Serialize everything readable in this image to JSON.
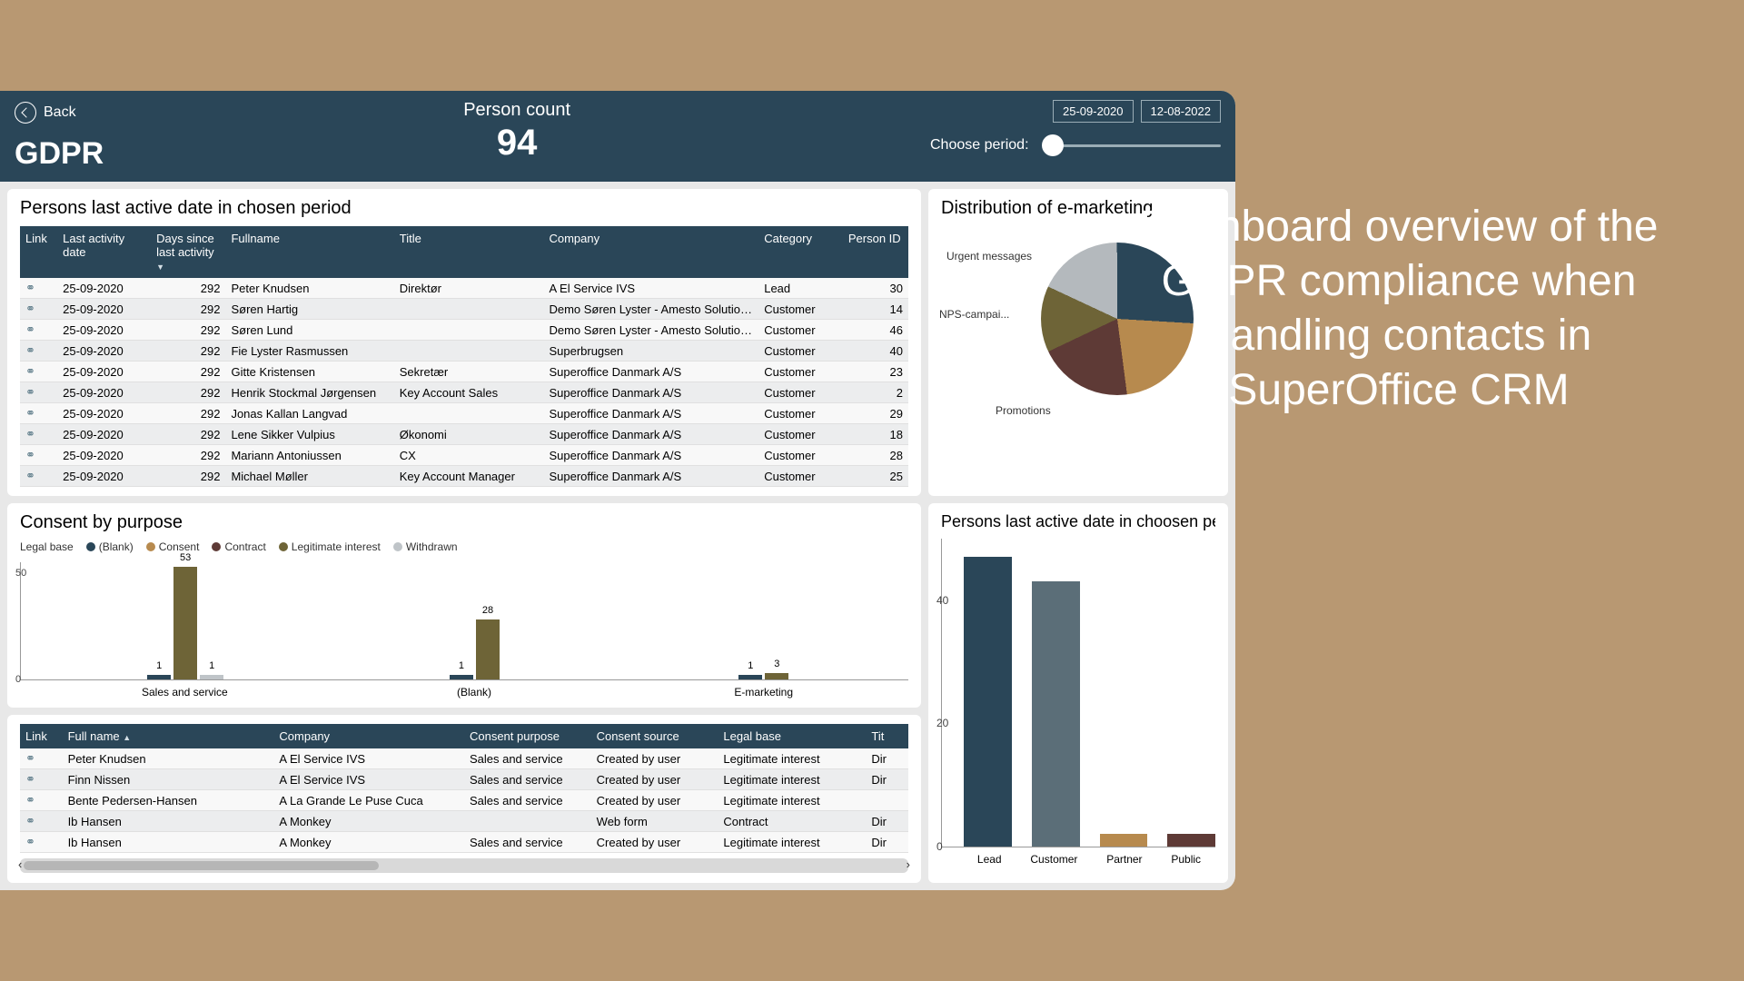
{
  "caption": "Dashboard overview of the GDPR compliance when handling contacts in SuperOffice CRM",
  "header": {
    "back": "Back",
    "title": "GDPR",
    "person_count_label": "Person count",
    "person_count": "94",
    "date_from": "25-09-2020",
    "date_to": "12-08-2022",
    "choose_period": "Choose period:"
  },
  "persons_panel": {
    "title": "Persons last active date in chosen period",
    "cols": [
      "Link",
      "Last activity date",
      "Days since last activity",
      "Fullname",
      "Title",
      "Company",
      "Category",
      "Person ID"
    ],
    "rows": [
      [
        "25-09-2020",
        "292",
        "Peter Knudsen",
        "Direktør",
        "A El Service IVS",
        "Lead",
        "30"
      ],
      [
        "25-09-2020",
        "292",
        "Søren Hartig",
        "",
        "Demo Søren Lyster - Amesto Solutions A/S",
        "Customer",
        "14"
      ],
      [
        "25-09-2020",
        "292",
        "Søren Lund",
        "",
        "Demo Søren Lyster - Amesto Solutions A/S",
        "Customer",
        "46"
      ],
      [
        "25-09-2020",
        "292",
        "Fie Lyster Rasmussen",
        "",
        "Superbrugsen",
        "Customer",
        "40"
      ],
      [
        "25-09-2020",
        "292",
        "Gitte Kristensen",
        "Sekretær",
        "Superoffice Danmark A/S",
        "Customer",
        "23"
      ],
      [
        "25-09-2020",
        "292",
        "Henrik Stockmal Jørgensen",
        "Key Account Sales",
        "Superoffice Danmark A/S",
        "Customer",
        "2"
      ],
      [
        "25-09-2020",
        "292",
        "Jonas Kallan Langvad",
        "",
        "Superoffice Danmark A/S",
        "Customer",
        "29"
      ],
      [
        "25-09-2020",
        "292",
        "Lene Sikker Vulpius",
        "Økonomi",
        "Superoffice Danmark A/S",
        "Customer",
        "18"
      ],
      [
        "25-09-2020",
        "292",
        "Mariann Antoniussen",
        "CX",
        "Superoffice Danmark A/S",
        "Customer",
        "28"
      ],
      [
        "25-09-2020",
        "292",
        "Michael Møller",
        "Key Account Manager",
        "Superoffice Danmark A/S",
        "Customer",
        "25"
      ]
    ]
  },
  "pie_panel": {
    "title": "Distribution of e-marketing",
    "labels": {
      "urgent": "Urgent messages",
      "nps": "NPS-campai...",
      "promotions": "Promotions"
    }
  },
  "consent_panel": {
    "title": "Consent by purpose",
    "legend_label": "Legal base",
    "legend": [
      {
        "name": "(Blank)",
        "color": "#2a4658"
      },
      {
        "name": "Consent",
        "color": "#b78a4e"
      },
      {
        "name": "Contract",
        "color": "#5e3a36"
      },
      {
        "name": "Legitimate interest",
        "color": "#6e6437"
      },
      {
        "name": "Withdrawn",
        "color": "#bfc4c8"
      }
    ]
  },
  "bar_panel": {
    "title": "Persons last active date in choosen period by Contact Cat"
  },
  "consent_table": {
    "cols": [
      "Link",
      "Full name",
      "Company",
      "Consent purpose",
      "Consent source",
      "Legal base",
      "Tit"
    ],
    "rows": [
      [
        "Peter Knudsen",
        "A El Service IVS",
        "Sales and service",
        "Created by user",
        "Legitimate interest",
        "Dir"
      ],
      [
        "Finn Nissen",
        "A El Service IVS",
        "Sales and service",
        "Created by user",
        "Legitimate interest",
        "Dir"
      ],
      [
        "Bente Pedersen-Hansen",
        "A La Grande Le Puse Cuca",
        "Sales and service",
        "Created by user",
        "Legitimate interest",
        ""
      ],
      [
        "Ib Hansen",
        "A Monkey",
        "",
        "Web form",
        "Contract",
        "Dir"
      ],
      [
        "Ib Hansen",
        "A Monkey",
        "Sales and service",
        "Created by user",
        "Legitimate interest",
        "Dir"
      ]
    ]
  },
  "chart_data": [
    {
      "type": "pie",
      "title": "Distribution of e-marketing",
      "series": [
        {
          "name": "Urgent messages",
          "value": 18,
          "color": "#b4b9bd"
        },
        {
          "name": "(unlabeled dark)",
          "value": 26,
          "color": "#2a4658"
        },
        {
          "name": "(unlabeled brown)",
          "value": 22,
          "color": "#b78a4e"
        },
        {
          "name": "Promotions",
          "value": 20,
          "color": "#5e3a36"
        },
        {
          "name": "NPS-campai...",
          "value": 14,
          "color": "#6e6437"
        }
      ]
    },
    {
      "type": "bar",
      "title": "Consent by purpose",
      "legend_dimension": "Legal base",
      "categories": [
        "Sales and service",
        "(Blank)",
        "E-marketing"
      ],
      "series": [
        {
          "name": "(Blank)",
          "color": "#2a4658",
          "values": [
            1,
            1,
            1
          ]
        },
        {
          "name": "Legitimate interest",
          "color": "#6e6437",
          "values": [
            53,
            28,
            3
          ]
        },
        {
          "name": "Withdrawn",
          "color": "#bfc4c8",
          "values": [
            1,
            0,
            0
          ]
        }
      ],
      "ylim": [
        0,
        55
      ],
      "yticks": [
        0,
        50
      ]
    },
    {
      "type": "bar",
      "title": "Persons last active date in choosen period by Contact Cat",
      "categories": [
        "Lead",
        "Customer",
        "Partner",
        "Public"
      ],
      "values": [
        47,
        43,
        2,
        2
      ],
      "colors": [
        "#2a4658",
        "#5b6e78",
        "#b78a4e",
        "#5e3a36"
      ],
      "ylim": [
        0,
        50
      ],
      "yticks": [
        0,
        20,
        40
      ]
    }
  ]
}
